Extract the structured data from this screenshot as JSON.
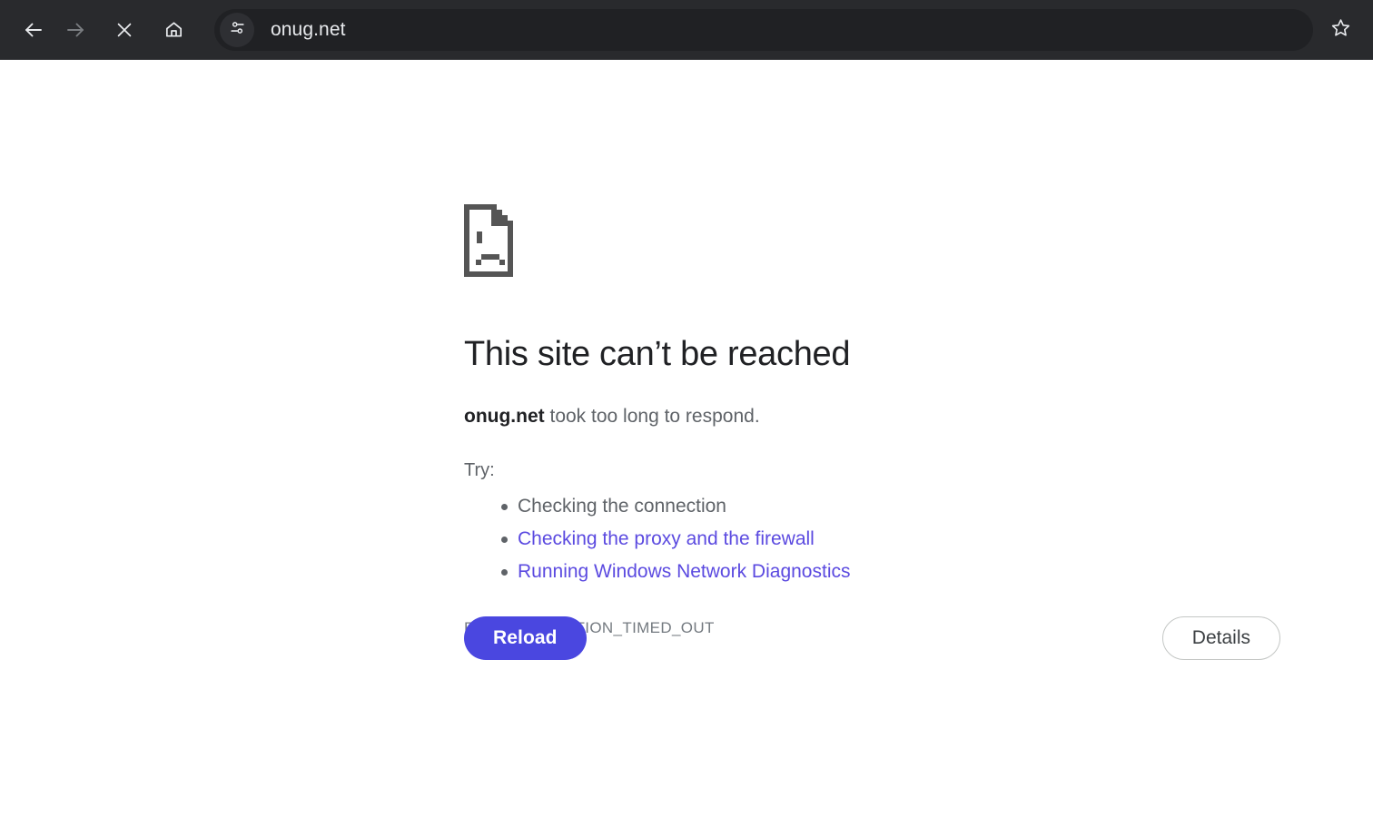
{
  "browser": {
    "toolbar": {
      "back_icon": "back-arrow-icon",
      "forward_icon": "forward-arrow-icon",
      "stop_icon": "close-x-icon",
      "home_icon": "home-icon",
      "site_info_icon": "tune-sliders-icon",
      "bookmark_icon": "star-outline-icon",
      "url_value": "onug.net",
      "url_placeholder": "Search Google or type a URL"
    },
    "colors": {
      "toolbar_bg": "#292a2d",
      "omnibox_bg": "#202124",
      "url_text": "#e8eaed"
    }
  },
  "error_page": {
    "icon_name": "sad-page-icon",
    "headline": "This site can’t be reached",
    "subtitle": {
      "host": "onug.net",
      "rest": " took too long to respond."
    },
    "try_label": "Try:",
    "suggestions": [
      {
        "label": "Checking the connection",
        "is_link": false
      },
      {
        "label": "Checking the proxy and the firewall",
        "is_link": true
      },
      {
        "label": "Running Windows Network Diagnostics",
        "is_link": true
      }
    ],
    "error_code": "ERR_CONNECTION_TIMED_OUT",
    "reload_label": "Reload",
    "details_label": "Details",
    "colors": {
      "headline": "#202124",
      "body_text": "#5f6368",
      "link": "#5b4ae0",
      "primary_button_bg": "#4a47e0",
      "primary_button_text": "#ffffff",
      "secondary_button_border": "#c4c7c5",
      "error_code_text": "#747a80"
    }
  }
}
